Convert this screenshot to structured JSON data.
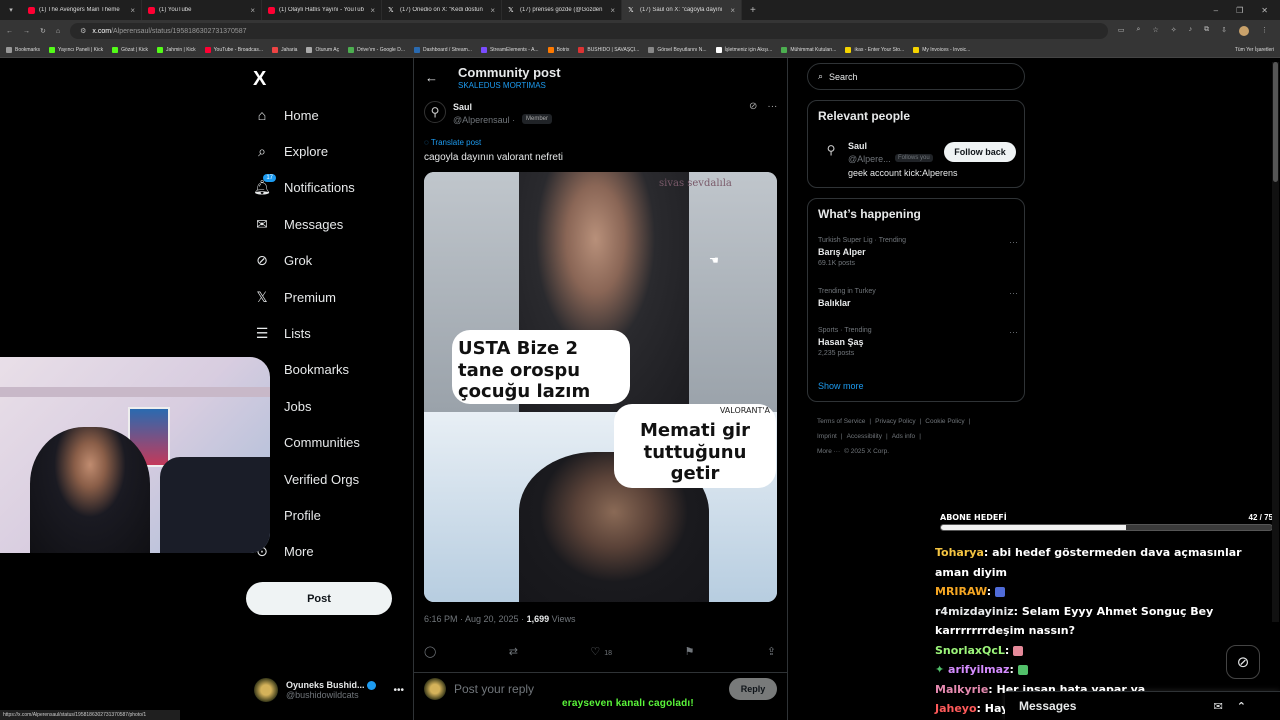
{
  "browser": {
    "tabs": [
      {
        "title": "(1) The Avengers Main Theme",
        "icon": "youtube-icon"
      },
      {
        "title": "(1) YouTube",
        "icon": "youtube-icon"
      },
      {
        "title": "(1) Olaylı Hatlıs Yayını - YouTub",
        "icon": "youtube-icon"
      },
      {
        "title": "(17) Onedio on X: \"Kedi dostun",
        "icon": "x-icon"
      },
      {
        "title": "(17) prenses gözde (@Gozden",
        "icon": "x-icon"
      },
      {
        "title": "(17) Saul on X: \"cagoyla dayını",
        "icon": "x-icon"
      }
    ],
    "url_host": "x.com",
    "url_path": "/Alperensaul/status/1958186302731370587",
    "bookmarks": [
      "Bookmarks",
      "Yayıncı Paneli | Kick",
      "Gözat | Kick",
      "Jahmin | Kick",
      "YouTube - Broadcas...",
      "Jaharia",
      "Oturum Aç",
      "Drive'ım - Google D...",
      "Dashboard / Stream...",
      "StreamElements - A...",
      "Botrix",
      "BUSHIDO | SAVAŞÇI...",
      "Görsel Boyutlarını N...",
      "İşletmeniz için Akışı...",
      "Mühimmat Kutuları...",
      "ikas - Enter Your Sto...",
      "My Invoices - Invoic..."
    ],
    "bookmarks_right": "Tüm Yer İşaretleri",
    "status_url": "https://x.com/Alperensaul/status/1958186302731370587/photo/1"
  },
  "nav": {
    "logo": "X",
    "items": [
      {
        "label": "Home",
        "icon": "home-icon"
      },
      {
        "label": "Explore",
        "icon": "search-icon"
      },
      {
        "label": "Notifications",
        "icon": "bell-icon",
        "badge": "17"
      },
      {
        "label": "Messages",
        "icon": "mail-icon"
      },
      {
        "label": "Grok",
        "icon": "grok-icon"
      },
      {
        "label": "Premium",
        "icon": "x-icon"
      },
      {
        "label": "Lists",
        "icon": "list-icon"
      },
      {
        "label": "Bookmarks",
        "icon": "bookmark-icon"
      },
      {
        "label": "Jobs",
        "icon": "briefcase-icon"
      },
      {
        "label": "Communities",
        "icon": "people-icon"
      },
      {
        "label": "Verified Orgs",
        "icon": "lightning-icon"
      },
      {
        "label": "Profile",
        "icon": "person-icon"
      },
      {
        "label": "More",
        "icon": "more-circle-icon"
      }
    ],
    "post_label": "Post",
    "account_name": "Oyuneks Bushid...",
    "account_handle": "@bushidowildcats"
  },
  "post": {
    "header_title": "Community post",
    "header_sub": "SKALEDUS MORTIMAS",
    "author_name": "Saul",
    "author_handle": "@Alperensaul ·",
    "member_tag": "Member",
    "translate": "Translate post",
    "text": "cagoyla dayının valorant nefreti",
    "meme_watermark": "sivas sevdalıla",
    "meme_bubble1": "USTA Bize 2 tane orospu çocuğu lazım",
    "meme_bubble2": "Memati gir tuttuğunu getir",
    "meme_tag": "VALORANT'A",
    "time": "6:16 PM · Aug 20, 2025 · ",
    "views_count": "1,699",
    "views_label": " Views",
    "likes": "18",
    "reply_placeholder": "Post your reply",
    "reply_button": "Reply",
    "overlay_text_a": "erayseven",
    "overlay_text_b": " kanalı cagoladı!"
  },
  "right": {
    "search_placeholder": "Search",
    "relevant_title": "Relevant people",
    "rp_name": "Saul",
    "rp_handle": "@Alpere...",
    "rp_follows": "Follows you",
    "rp_button": "Follow back",
    "rp_bio": "geek account kick:Alperens",
    "happening_title": "What’s happening",
    "trends": [
      {
        "cat": "Turkish Super Lig · Trending",
        "name": "Barış Alper",
        "count": "69.1K posts"
      },
      {
        "cat": "Trending in Turkey",
        "name": "Balıklar",
        "count": ""
      },
      {
        "cat": "Sports · Trending",
        "name": "Hasan Şaş",
        "count": "2,235 posts"
      }
    ],
    "show_more": "Show more",
    "footer": [
      "Terms of Service",
      "|",
      "Privacy Policy",
      "|",
      "Cookie Policy",
      "|",
      "Imprint",
      "|",
      "Accessibility",
      "|",
      "Ads info",
      "|",
      "More ···",
      "© 2025 X Corp."
    ]
  },
  "stream": {
    "goal_label": "ABONE HEDEFİ",
    "goal_current": 42,
    "goal_target": 75,
    "goal_count_text": "42 / 75",
    "chat": [
      {
        "user": "Toharya",
        "color": "#f5c542",
        "msg": ": abi hedef göstermeden dava açmasınlar aman diyim"
      },
      {
        "user": "MRIRAW",
        "color": "#f5a623",
        "msg": ": ",
        "emote": "#4f6bd8"
      },
      {
        "user": "r4mizdayiniz",
        "color": "#e7e9ea",
        "msg": ": Selam Eyyy Ahmet Songuç Bey karrrrrrrdeşim nassın?"
      },
      {
        "user": "SnorlaxQcL",
        "color": "#9cf57a",
        "msg": ": ",
        "emote": "#e58a9a"
      },
      {
        "user": "arifyilmaz",
        "color": "#d58cff",
        "msg": ": ",
        "emote": "#52c06a",
        "prefix": "✦ "
      },
      {
        "user": "Malkyrie",
        "color": "#e58ab0",
        "msg": ": Her insan hata yapar ya"
      },
      {
        "user": "Jaheyo",
        "color": "#ff5a5a",
        "msg": ": Hayat bu öğrenmesi lazım"
      }
    ],
    "messages_label": "Messages"
  }
}
